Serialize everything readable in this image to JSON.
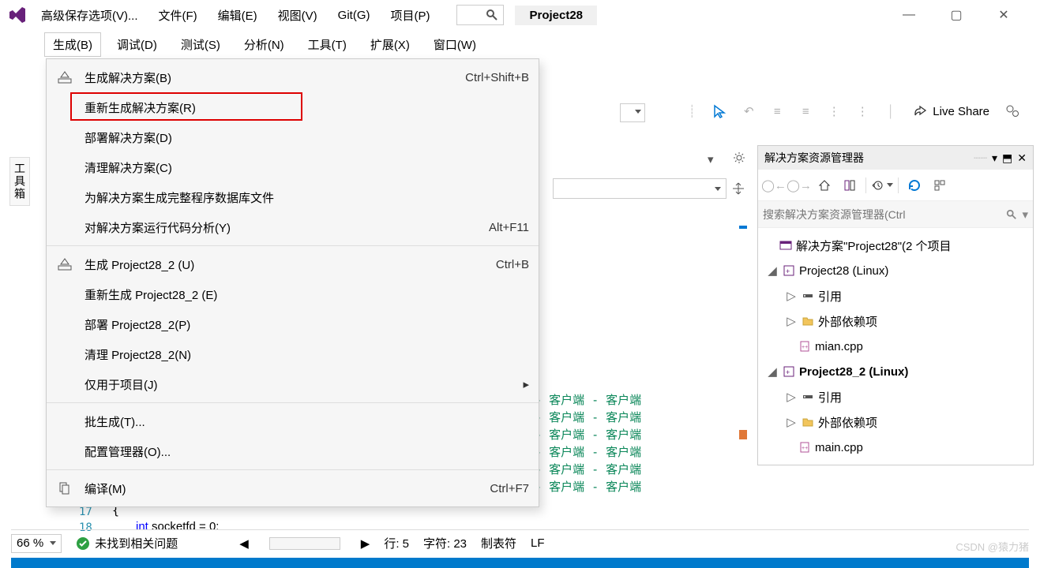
{
  "title": {
    "advanced_save": "高级保存选项(V)...",
    "project_name": "Project28"
  },
  "menubar1": {
    "file": "文件(F)",
    "edit": "编辑(E)",
    "view": "视图(V)",
    "git": "Git(G)",
    "project": "项目(P)"
  },
  "menubar2": {
    "build": "生成(B)",
    "debug": "调试(D)",
    "test": "测试(S)",
    "analyze": "分析(N)",
    "tools": "工具(T)",
    "extensions": "扩展(X)",
    "window": "窗口(W)"
  },
  "dropdown": [
    {
      "label": "生成解决方案(B)",
      "shortcut": "Ctrl+Shift+B",
      "icon": true
    },
    {
      "label": "重新生成解决方案(R)",
      "highlight": true
    },
    {
      "label": "部署解决方案(D)"
    },
    {
      "label": "清理解决方案(C)"
    },
    {
      "label": "为解决方案生成完整程序数据库文件"
    },
    {
      "label": "对解决方案运行代码分析(Y)",
      "shortcut": "Alt+F11"
    },
    {
      "sep": true
    },
    {
      "label": "生成 Project28_2 (U)",
      "shortcut": "Ctrl+B",
      "icon": true
    },
    {
      "label": "重新生成 Project28_2 (E)"
    },
    {
      "label": "部署 Project28_2(P)"
    },
    {
      "label": "清理 Project28_2(N)"
    },
    {
      "label": "仅用于项目(J)",
      "submenu": true
    },
    {
      "sep": true
    },
    {
      "label": "批生成(T)..."
    },
    {
      "label": "配置管理器(O)..."
    },
    {
      "sep": true
    },
    {
      "label": "编译(M)",
      "shortcut": "Ctrl+F7",
      "icon": true,
      "compileIcon": true
    }
  ],
  "toolbox_tab": "工具箱",
  "live_share": "Live Share",
  "solution_explorer": {
    "title": "解决方案资源管理器",
    "search_placeholder": "搜索解决方案资源管理器(Ctrl",
    "solution_label": "解决方案\"Project28\"(2 个项目",
    "tree": {
      "proj1": "Project28 (Linux)",
      "refs": "引用",
      "external": "外部依赖项",
      "mian": "mian.cpp",
      "proj2": "Project28_2 (Linux)",
      "main": "main.cpp"
    }
  },
  "code": {
    "green_lines": "端 - 客户端 - 客户端\n端 - 客户端 - 客户端\n端 - 客户端 - 客户端\n端 - 客户端 - 客户端\n端 - 客户端 - 客户端\n端 - 客户端 - 客户端",
    "line17": "17",
    "line18": "18",
    "brace": "{",
    "decl_kw": "int",
    "decl_rest": " socketfd = 0:"
  },
  "statusbar": {
    "zoom": "66 %",
    "no_issues": "未找到相关问题",
    "line": "行: 5",
    "col": "字符: 23",
    "tabs": "制表符",
    "lf": "LF"
  },
  "watermark": "CSDN @猿力猪"
}
